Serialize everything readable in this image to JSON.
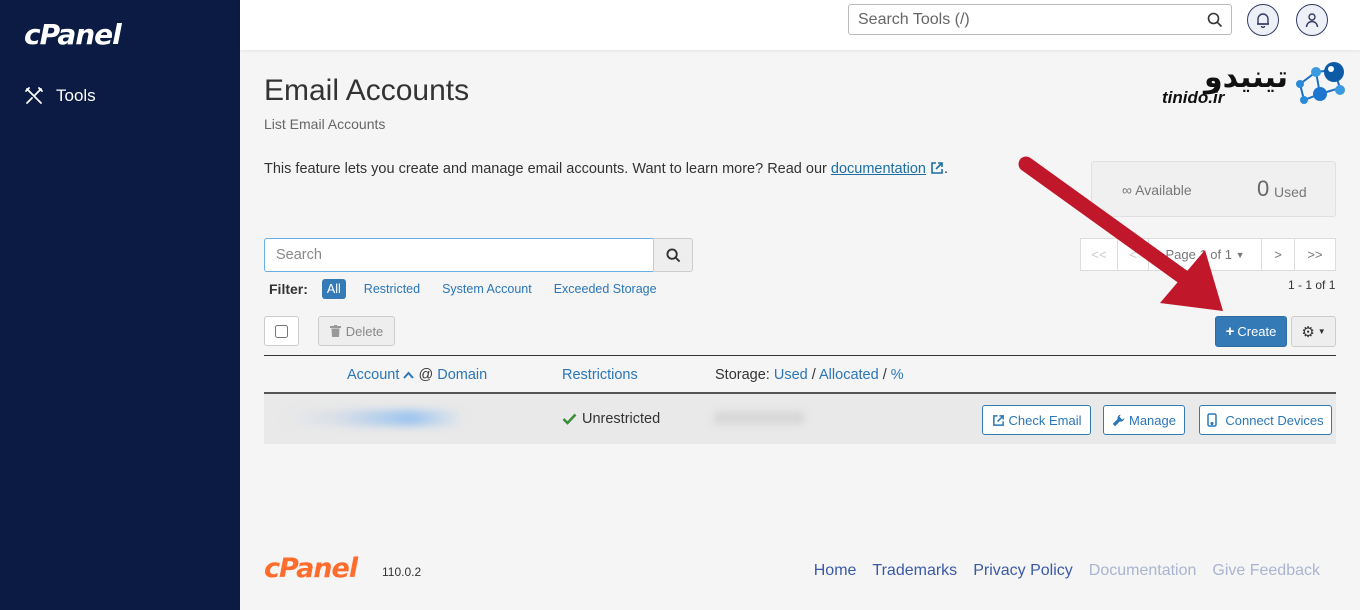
{
  "sidebar": {
    "logo": "cPanel",
    "nav": [
      {
        "label": "Tools",
        "icon": "tools-icon"
      }
    ]
  },
  "header": {
    "search_placeholder": "Search Tools (/)",
    "icons": [
      "bell-icon",
      "user-icon"
    ]
  },
  "page": {
    "title": "Email Accounts",
    "subtitle": "List Email Accounts",
    "intro_text": "This feature lets you create and manage email accounts. Want to learn more? Read our ",
    "intro_link": "documentation",
    "intro_end": "."
  },
  "brand": {
    "persian": "تینیدو",
    "latin": "tinido.ir"
  },
  "usage": {
    "available_symbol": "∞",
    "available_label": "Available",
    "used_count": "0",
    "used_label": "Used"
  },
  "account_search": {
    "placeholder": "Search"
  },
  "filters": {
    "label": "Filter:",
    "items": [
      "All",
      "Restricted",
      "System Account",
      "Exceeded Storage"
    ],
    "active": "All"
  },
  "pagination": {
    "first": "<<",
    "prev": "<",
    "page_label": "Page 1 of 1",
    "next": ">",
    "last": ">>",
    "range": "1 - 1 of 1"
  },
  "toolbar": {
    "delete_label": "Delete",
    "create_label": "Create"
  },
  "table": {
    "headers": {
      "account": "Account",
      "at": "@",
      "domain": "Domain",
      "restrictions": "Restrictions",
      "storage_prefix": "Storage:",
      "used": "Used",
      "allocated": "Allocated",
      "percent": "%"
    },
    "rows": [
      {
        "restriction": "Unrestricted",
        "actions": [
          "Check Email",
          "Manage",
          "Connect Devices"
        ]
      }
    ]
  },
  "footer": {
    "logo": "cPanel",
    "version": "110.0.2",
    "links": [
      "Home",
      "Trademarks",
      "Privacy Policy",
      "Documentation",
      "Give Feedback"
    ]
  },
  "colors": {
    "sidebar": "#0c1b44",
    "accent": "#337ab7",
    "annotation_arrow": "#c0172b",
    "footer_logo": "#ff6c2c"
  }
}
